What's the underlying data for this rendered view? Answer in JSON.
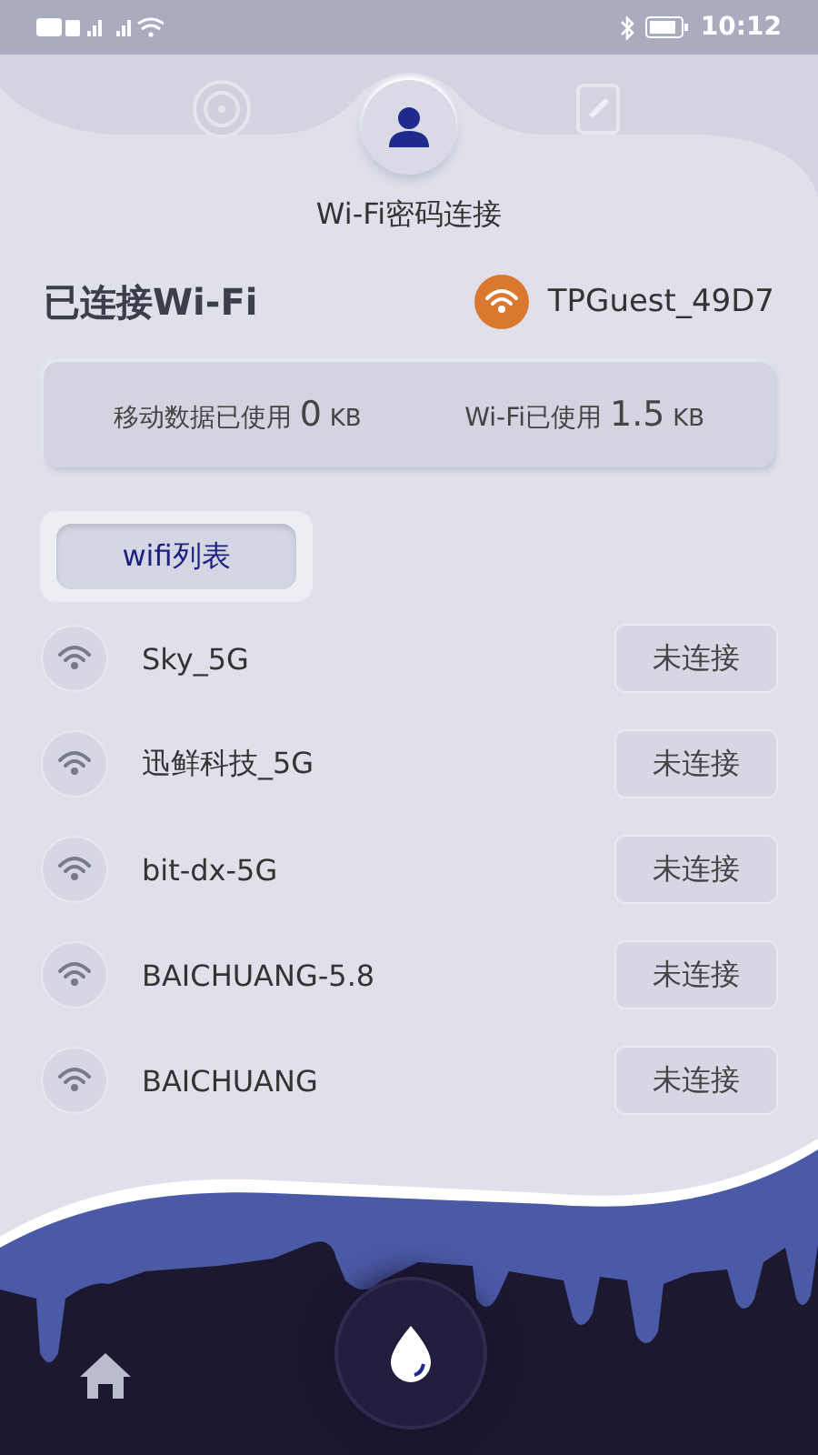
{
  "status_bar": {
    "time": "10:12"
  },
  "nav_tabs": [
    {
      "kind": "gauge",
      "selected": false
    },
    {
      "kind": "person",
      "selected": true
    },
    {
      "kind": "note",
      "selected": false
    }
  ],
  "page_title": "Wi-Fi密码连接",
  "connected": {
    "label": "已连接Wi-Fi",
    "network": "TPGuest_49D7"
  },
  "usage": [
    {
      "label": "移动数据已使用",
      "value": "0",
      "unit": "KB"
    },
    {
      "label": "Wi-Fi已使用",
      "value": "1.5",
      "unit": "KB"
    }
  ],
  "list_tab": "wifi列表",
  "networks": [
    {
      "name": "Sky_5G",
      "action": "未连接"
    },
    {
      "name": "迅鲜科技_5G",
      "action": "未连接"
    },
    {
      "name": "bit-dx-5G",
      "action": "未连接"
    },
    {
      "name": "BAICHUANG-5.8",
      "action": "未连接"
    },
    {
      "name": "BAICHUANG",
      "action": "未连接"
    }
  ]
}
